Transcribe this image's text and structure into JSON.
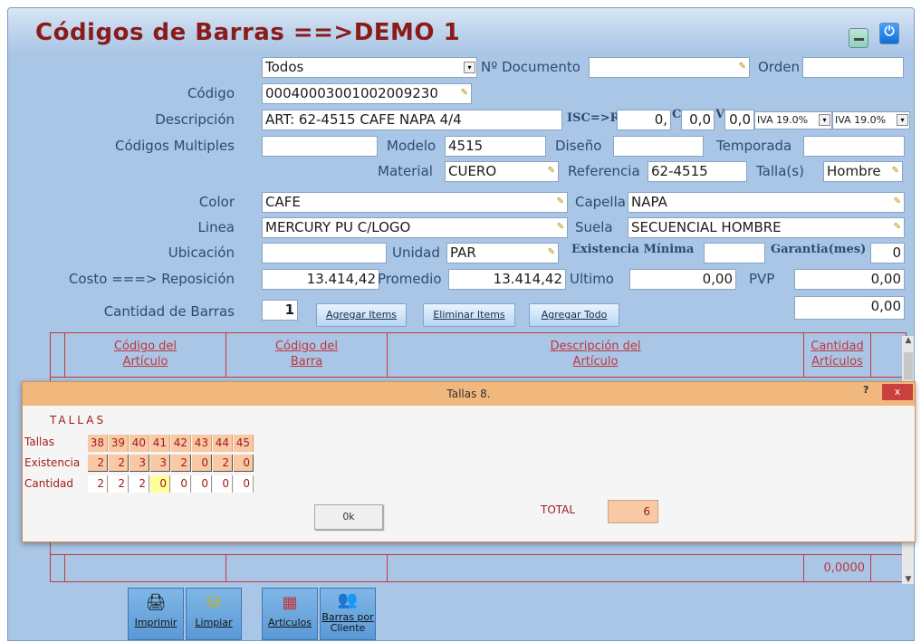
{
  "window": {
    "title": "Códigos de Barras ==>DEMO 1"
  },
  "form": {
    "doc_type": "Todos",
    "num_doc_label": "Nº Documento",
    "num_doc_value": "",
    "orden_label": "Orden",
    "orden_value": "",
    "codigo_label": "Código",
    "codigo_value": "00040003001002009230",
    "descripcion_label": "Descripción",
    "descripcion_value": "ART: 62-4515 CAFE NAPA 4/4",
    "isc_label": "ISC=>R",
    "isc_value": "0,",
    "c_label": "C",
    "c_value": "0,0",
    "v_label": "V",
    "v_value": "0,0",
    "iva1": "IVA 19.0%",
    "iva2": "IVA 19.0%",
    "codigos_multiples_label": "Códigos Multiples",
    "codigos_multiples_value": "",
    "modelo_label": "Modelo",
    "modelo_value": "4515",
    "diseno_label": "Diseño",
    "diseno_value": "",
    "temporada_label": "Temporada",
    "temporada_value": "",
    "material_label": "Material",
    "material_value": "CUERO",
    "referencia_label": "Referencia",
    "referencia_value": "62-4515",
    "tallas_label": "Talla(s)",
    "tallas_value": "Hombre",
    "color_label": "Color",
    "color_value": "CAFE",
    "capella_label": "Capella",
    "capella_value": "NAPA",
    "linea_label": "Linea",
    "linea_value": "MERCURY PU C/LOGO",
    "suela_label": "Suela",
    "suela_value": "SECUENCIAL HOMBRE",
    "ubicacion_label": "Ubicación",
    "ubicacion_value": "",
    "unidad_label": "Unidad",
    "unidad_value": "PAR",
    "existencia_minima_label": "Existencia Mínima",
    "existencia_minima_value": "",
    "garantia_label": "Garantia(mes)",
    "garantia_value": "0",
    "costo_label": "Costo ===> Reposición",
    "costo_value": "13.414,42",
    "promedio_label": "Promedio",
    "promedio_value": "13.414,42",
    "ultimo_label": "Ultimo",
    "ultimo_value": "0,00",
    "pvp_label": "PVP",
    "pvp_value": "0,00",
    "pvp2_value": "0,00",
    "cantidad_barras_label": "Cantidad de Barras",
    "cantidad_barras_value": "1"
  },
  "buttons": {
    "agregar_items": "Agregar Items",
    "eliminar_items": "Eliminar Items",
    "agregar_todo": "Agregar Todo"
  },
  "grid": {
    "col1_a": "Código del",
    "col1_b": "Artículo",
    "col2_a": "Código del",
    "col2_b": "Barra",
    "col3_a": "Descripción del",
    "col3_b": "Artículo",
    "col4_a": "Cantidad",
    "col4_b": "Artículos",
    "total": "0,0000"
  },
  "dialog": {
    "title": "Tallas 8.",
    "help": "?",
    "close": "x",
    "heading": "TALLAS",
    "row_tallas": "Tallas",
    "row_existencia": "Existencia",
    "row_cantidad": "Cantidad",
    "tallas": [
      "38",
      "39",
      "40",
      "41",
      "42",
      "43",
      "44",
      "45"
    ],
    "existencia": [
      "2",
      "2",
      "3",
      "3",
      "2",
      "0",
      "2",
      "0"
    ],
    "cantidad": [
      "2",
      "2",
      "2",
      "0",
      "0",
      "0",
      "0",
      "0"
    ],
    "ok": "0k",
    "total_label": "TOTAL",
    "total_value": "6"
  },
  "toolbar": {
    "imprimir": "Imprimir",
    "limpiar": "Limpiar",
    "articulos": "Articulos",
    "barras_cliente_a": "Barras por",
    "barras_cliente_b": "Cliente"
  }
}
